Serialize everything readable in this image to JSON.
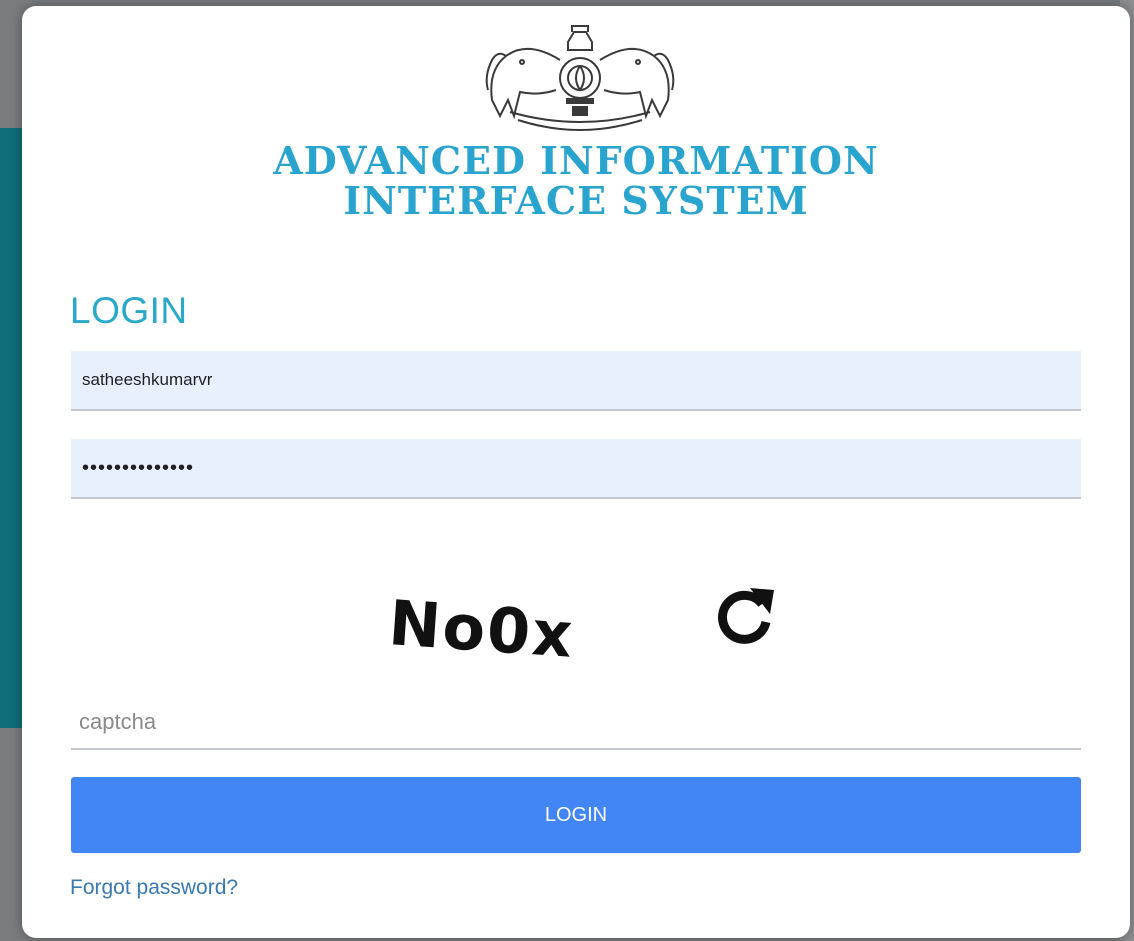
{
  "brand": {
    "emblem_icon": "kerala-state-emblem-icon",
    "line1": "ADVANCED INFORMATION",
    "line2": "INTERFACE SYSTEM",
    "color": "#29a4cf"
  },
  "login": {
    "title": "LOGIN",
    "username_value": "satheeshkumarvr",
    "password_value": "••••••••••••••",
    "captcha_text": "No0x",
    "refresh_icon": "refresh-icon",
    "captcha_placeholder": "captcha",
    "button_label": "LOGIN",
    "forgot_label": "Forgot password?",
    "accent_color": "#4285f4",
    "title_color": "#2aa8c7"
  }
}
